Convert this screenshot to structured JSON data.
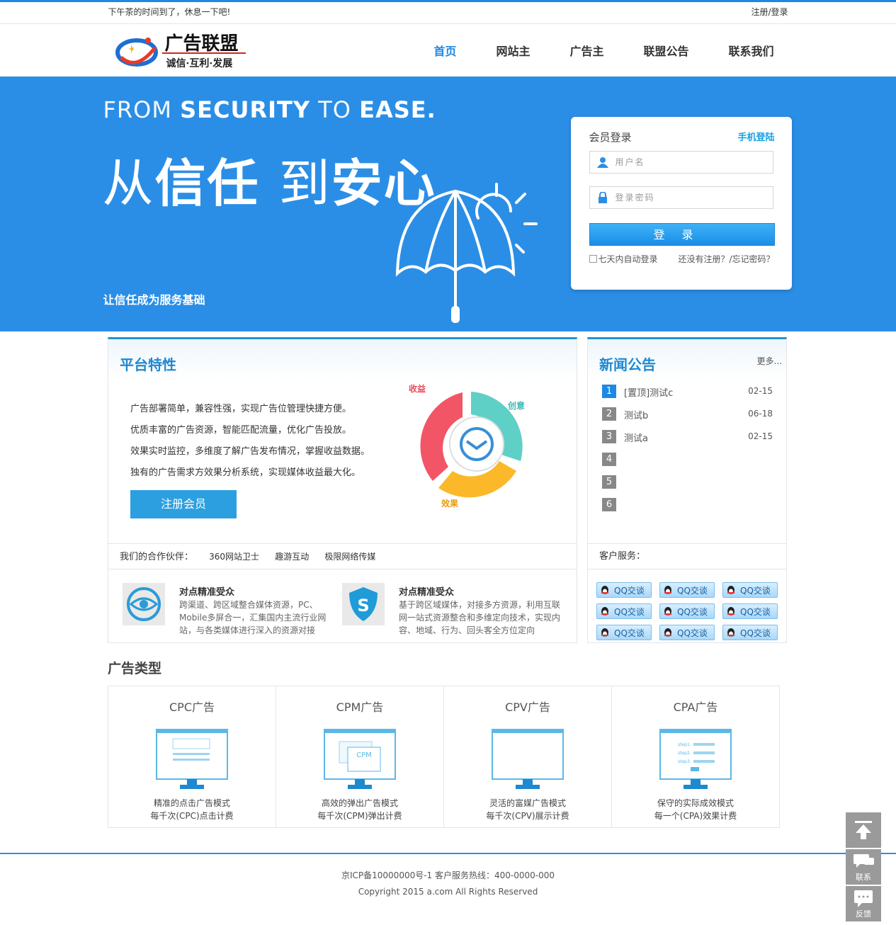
{
  "topbar": {
    "greeting": "下午茶的时间到了，休息一下吧!",
    "auth": "注册/登录"
  },
  "logo": {
    "name": "广告联盟",
    "slogan": "诚信·互利·发展"
  },
  "nav": [
    {
      "label": "首页",
      "active": true
    },
    {
      "label": "网站主"
    },
    {
      "label": "广告主"
    },
    {
      "label": "联盟公告"
    },
    {
      "label": "联系我们"
    }
  ],
  "banner": {
    "en_from": "FROM",
    "en_security": "SECURITY",
    "en_to": "TO",
    "en_ease": "EASE.",
    "cn_1": "从",
    "cn_2": "信任",
    "cn_3": "到",
    "cn_4": "安心",
    "sub": "让信任成为服务基础"
  },
  "login": {
    "title": "会员登录",
    "mobile": "手机登陆",
    "user_placeholder": "用户名",
    "pass_placeholder": "登录密码",
    "button": "登录",
    "remember": "七天内自动登录",
    "register": "还没有注册？/忘记密码？"
  },
  "features": {
    "title": "平台特性",
    "lines": [
      "广告部署简单，兼容性强，实现广告位管理快捷方便。",
      "优质丰富的广告资源，智能匹配流量，优化广告投放。",
      "效果实时监控，多维度了解广告发布情况，掌握收益数据。",
      "独有的广告需求方效果分析系统，实现媒体收益最大化。"
    ],
    "register_btn": "注册会员",
    "ring": {
      "income": "收益",
      "creative": "创意",
      "effect": "效果"
    }
  },
  "partners": {
    "label": "我们的合作伙伴：",
    "items": [
      "360网站卫士",
      "趣游互动",
      "极限网络传媒"
    ]
  },
  "cards": [
    {
      "title": "对点精准受众",
      "desc": "跨渠道、跨区域整合媒体资源，PC、Mobile多屏合一，汇集国内主流行业网站，与各类媒体进行深入的资源对接"
    },
    {
      "title": "对点精准受众",
      "desc": "基于跨区域媒体，对接多方资源，利用互联网一站式资源整合和多维定向技术，实现内容、地域、行为、回头客全方位定向"
    }
  ],
  "news": {
    "title": "新闻公告",
    "more": "更多...",
    "items": [
      {
        "n": "1",
        "title": "[置顶]测试c",
        "date": "02-15"
      },
      {
        "n": "2",
        "title": "测试b",
        "date": "06-18"
      },
      {
        "n": "3",
        "title": "测试a",
        "date": "02-15"
      },
      {
        "n": "4",
        "title": "",
        "date": ""
      },
      {
        "n": "5",
        "title": "",
        "date": ""
      },
      {
        "n": "6",
        "title": "",
        "date": ""
      }
    ]
  },
  "service": {
    "label": "客户服务：",
    "qq_label": "QQ交谈"
  },
  "types": {
    "title": "广告类型",
    "items": [
      {
        "name": "CPC广告",
        "d1": "精准的点击广告模式",
        "d2": "每千次(CPC)点击计费"
      },
      {
        "name": "CPM广告",
        "d1": "高效的弹出广告模式",
        "d2": "每千次(CPM)弹出计费",
        "screen_text": "CPM"
      },
      {
        "name": "CPV广告",
        "d1": "灵活的富媒广告模式",
        "d2": "每千次(CPV)展示计费"
      },
      {
        "name": "CPA广告",
        "d1": "保守的实际成效模式",
        "d2": "每一个(CPA)效果计费",
        "steps": [
          "step1.",
          "step2.",
          "step3."
        ]
      }
    ]
  },
  "footer": {
    "icp": "京ICP备10000000号-1 客户服务热线：400-0000-000",
    "copyright": "Copyright 2015 a.com All Rights Reserved"
  },
  "side": {
    "contact": "联系",
    "feedback": "反馈"
  },
  "colors": {
    "brand": "#2b8ee6",
    "accent": "#1e88d0"
  }
}
